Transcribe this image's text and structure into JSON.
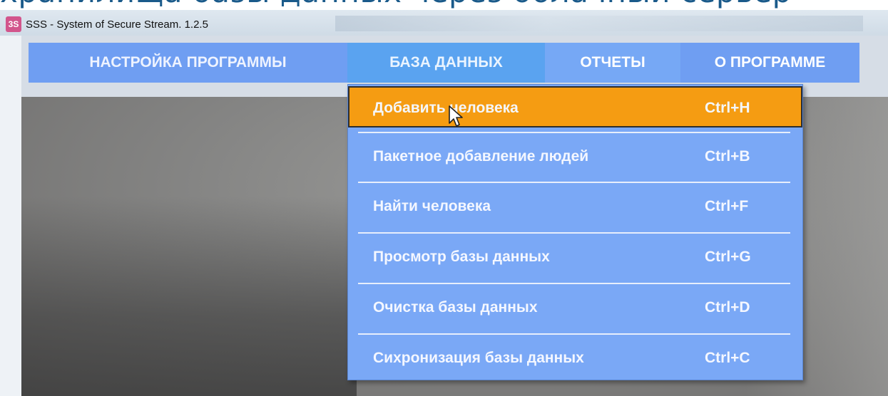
{
  "slide": {
    "caption": "хранилища базы данных через облачный сервер"
  },
  "window": {
    "title": "SSS - System of Secure Stream. 1.2.5",
    "icon_label": "3S"
  },
  "menubar": {
    "items": [
      {
        "label": "НАСТРОЙКА ПРОГРАММЫ"
      },
      {
        "label": "БАЗА ДАННЫХ"
      },
      {
        "label": "ОТЧЕТЫ"
      },
      {
        "label": "О ПРОГРАММЕ"
      }
    ]
  },
  "dropdown": {
    "items": [
      {
        "label": "Добавить человека",
        "shortcut": "Ctrl+H",
        "active": true
      },
      {
        "label": "Пакетное добавление людей",
        "shortcut": "Ctrl+B"
      },
      {
        "label": "Найти человека",
        "shortcut": "Ctrl+F"
      },
      {
        "label": "Просмотр базы данных",
        "shortcut": "Ctrl+G"
      },
      {
        "label": "Очистка базы данных",
        "shortcut": "Ctrl+D"
      },
      {
        "label": "Сихронизация базы данных",
        "shortcut": "Ctrl+C"
      }
    ]
  },
  "colors": {
    "menu_bg": "#7ca9f4",
    "active_item": "#f59c12",
    "dropdown_bg": "#7aa8f6"
  }
}
